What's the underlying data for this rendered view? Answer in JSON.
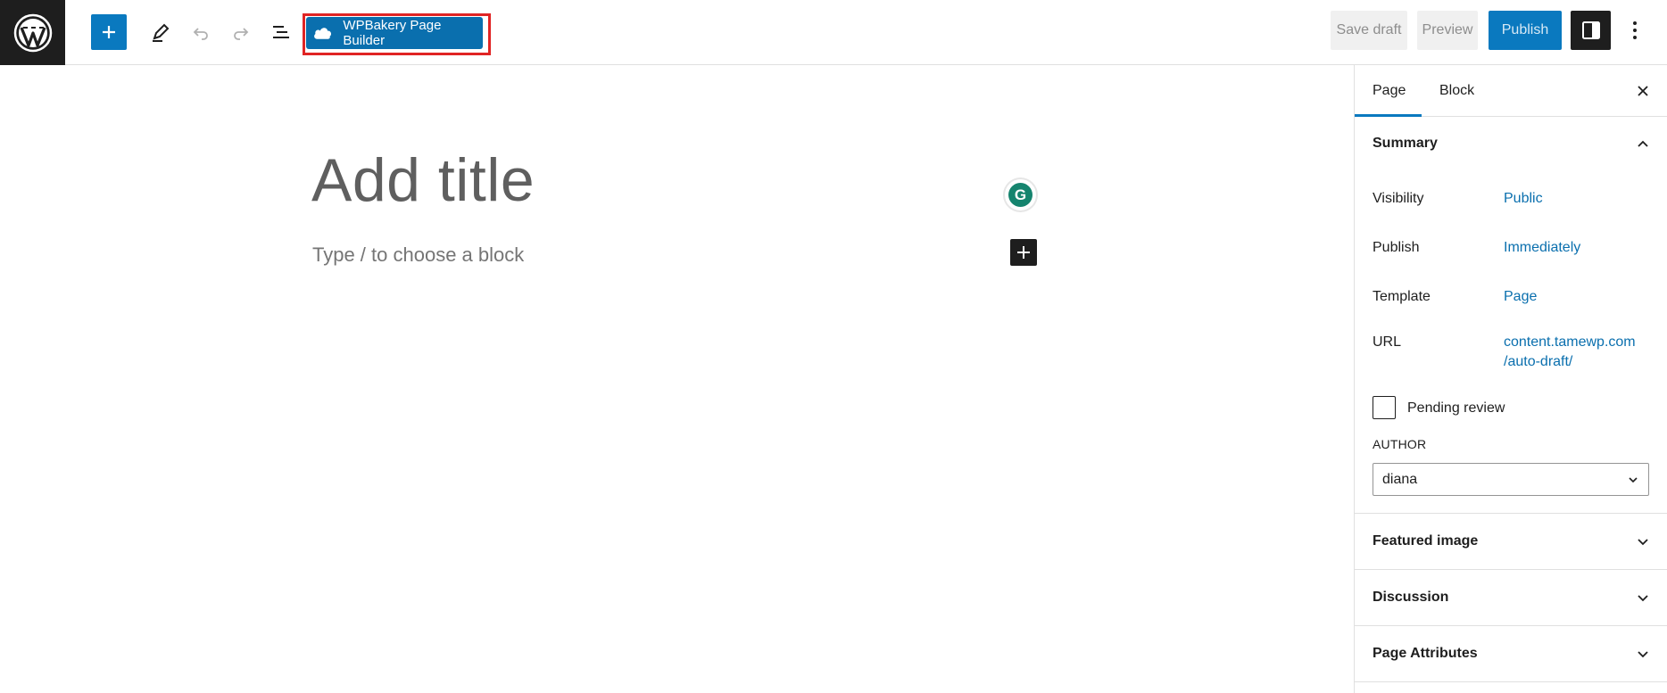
{
  "toolbar": {
    "wpbakery_label": "WPBakery Page Builder",
    "save_draft_label": "Save draft",
    "preview_label": "Preview",
    "publish_label": "Publish"
  },
  "editor": {
    "title_placeholder": "Add title",
    "block_placeholder": "Type / to choose a block",
    "grammarly_letter": "G"
  },
  "sidebar": {
    "tabs": [
      {
        "label": "Page",
        "active": true
      },
      {
        "label": "Block",
        "active": false
      }
    ],
    "summary": {
      "title": "Summary",
      "rows": [
        {
          "label": "Visibility",
          "value": "Public"
        },
        {
          "label": "Publish",
          "value": "Immediately"
        },
        {
          "label": "Template",
          "value": "Page"
        },
        {
          "label": "URL",
          "value_line1": "content.tamewp.com",
          "value_line2": "/auto-draft/"
        }
      ],
      "pending_review_label": "Pending review",
      "author_label": "AUTHOR",
      "author_value": "diana"
    },
    "panels": [
      {
        "title": "Featured image"
      },
      {
        "title": "Discussion"
      },
      {
        "title": "Page Attributes"
      }
    ]
  },
  "colors": {
    "accent": "#0a79bf",
    "link": "#0a6fae",
    "highlight_border": "#e02424"
  }
}
